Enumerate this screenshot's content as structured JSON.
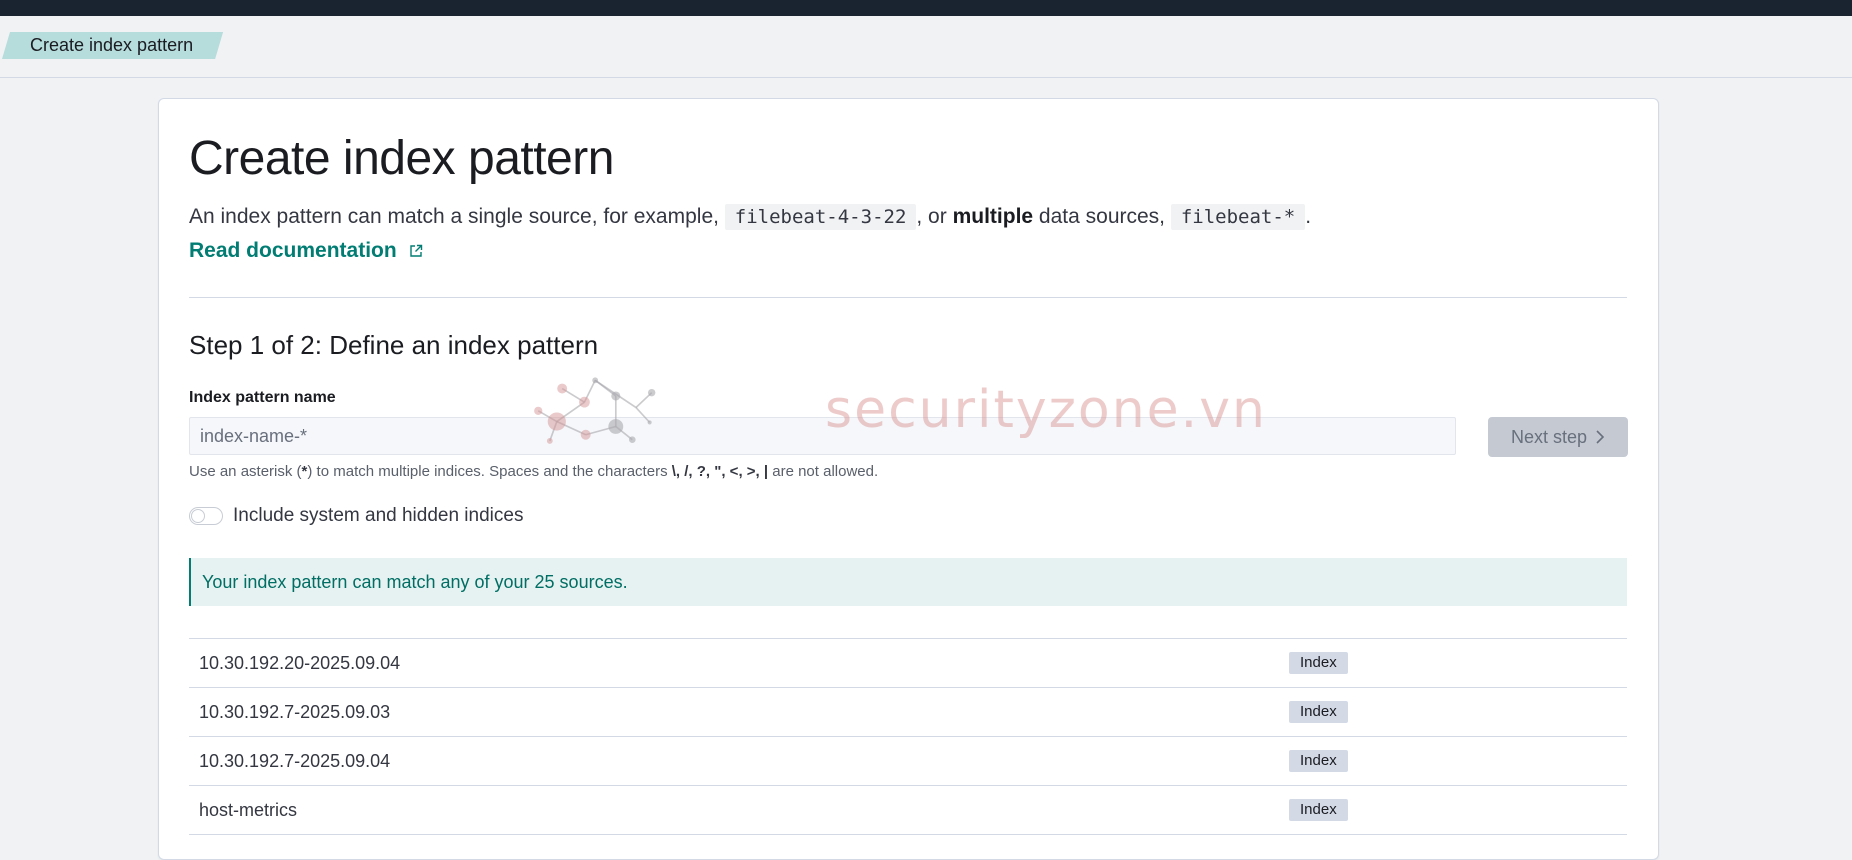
{
  "breadcrumb": {
    "current": "Create index pattern"
  },
  "page": {
    "title": "Create index pattern",
    "description": {
      "part1": "An index pattern can match a single source, for example, ",
      "example_single": "filebeat-4-3-22",
      "part2": ", or ",
      "strong": "multiple",
      "part3": " data sources, ",
      "example_multi": "filebeat-*",
      "part4": "."
    },
    "doc_link": "Read documentation"
  },
  "step": {
    "title": "Step 1 of 2: Define an index pattern",
    "field_label": "Index pattern name",
    "input_placeholder": "index-name-*",
    "input_value": "",
    "next_button": "Next step",
    "help": {
      "before": "Use an asterisk (",
      "asterisk": "*",
      "middle": ") to match multiple indices. Spaces and the characters ",
      "chars": "\\, /, ?, \", <, >, |",
      "after": " are not allowed."
    },
    "toggle_label": "Include system and hidden indices",
    "toggle_on": false,
    "callout": "Your index pattern can match any of your 25 sources."
  },
  "indices": [
    {
      "name": "10.30.192.20-2025.09.04",
      "type": "Index"
    },
    {
      "name": "10.30.192.7-2025.09.03",
      "type": "Index"
    },
    {
      "name": "10.30.192.7-2025.09.04",
      "type": "Index"
    },
    {
      "name": "host-metrics",
      "type": "Index"
    }
  ],
  "watermark": {
    "text": "securityzone.vn"
  },
  "colors": {
    "accent": "#017d73",
    "topbar": "#1a2330",
    "callout_bg": "#e6f2f1",
    "badge_bg": "#d3dae6"
  }
}
